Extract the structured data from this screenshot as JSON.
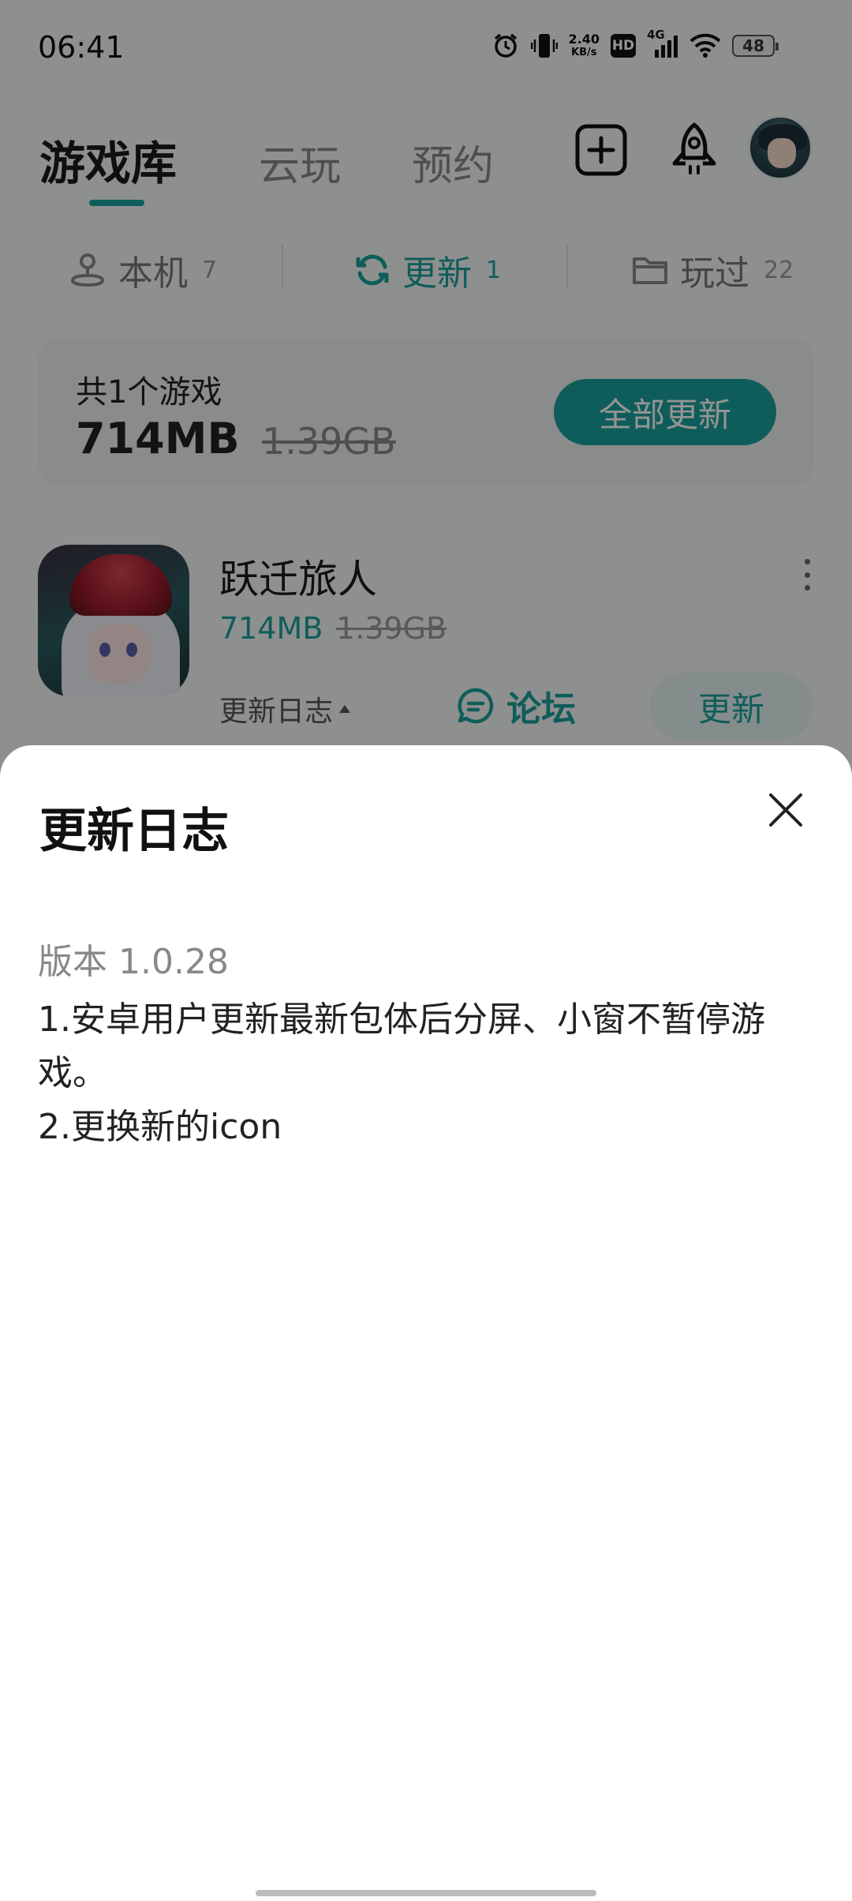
{
  "status_bar": {
    "time": "06:41",
    "net_speed_value": "2.40",
    "net_speed_unit": "KB/s",
    "hd_label": "HD",
    "signal_label": "4G",
    "battery": "48"
  },
  "header": {
    "tabs": [
      {
        "label": "游戏库",
        "active": true
      },
      {
        "label": "云玩",
        "active": false
      },
      {
        "label": "预约",
        "active": false
      }
    ]
  },
  "filters": [
    {
      "label": "本机",
      "count": "7"
    },
    {
      "label": "更新",
      "count": "1",
      "active": true
    },
    {
      "label": "玩过",
      "count": "22"
    }
  ],
  "summary": {
    "title": "共1个游戏",
    "size": "714MB",
    "original_size": "1.39GB",
    "update_all_label": "全部更新"
  },
  "game": {
    "name": "跃迁旅人",
    "size": "714MB",
    "original_size": "1.39GB",
    "changelog_label": "更新日志",
    "forum_label": "论坛",
    "update_label": "更新"
  },
  "sheet": {
    "title": "更新日志",
    "version": "版本 1.0.28",
    "notes": [
      "1.安卓用户更新最新包体后分屏、小窗不暂停游戏。",
      "2.更换新的icon"
    ]
  },
  "colors": {
    "accent": "#1aa19b",
    "overlay": "rgba(0,0,0,0.42)"
  }
}
